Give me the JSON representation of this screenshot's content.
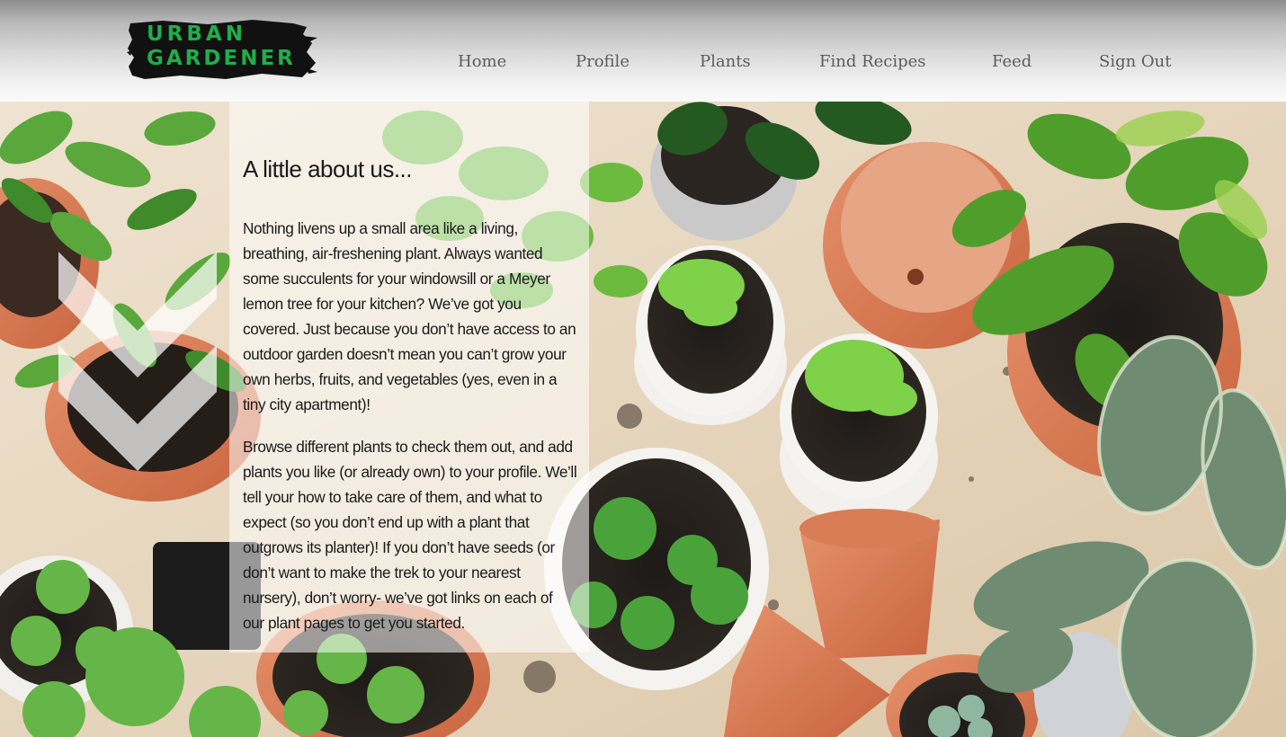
{
  "header": {
    "logo": {
      "line1": "URBAN",
      "line2": "GARDENER"
    },
    "nav": [
      {
        "label": "Home"
      },
      {
        "label": "Profile"
      },
      {
        "label": "Plants"
      },
      {
        "label": "Find Recipes"
      },
      {
        "label": "Feed"
      },
      {
        "label": "Sign Out"
      }
    ]
  },
  "about": {
    "title": "A little about us...",
    "paragraphs": [
      "Nothing livens up a small area like a living, breathing, air-freshening plant. Always wanted some succulents for your windowsill or a Meyer lemon tree for your kitchen? We’ve got you covered. Just because you don’t have access to an outdoor garden doesn’t mean you can’t grow your own herbs, fruits, and vegetables (yes, even in a tiny city apartment)!",
      "Browse different plants to check them out, and add plants you like (or already own) to your profile. We’ll tell your how to take care of them, and what to expect (so you don’t end up with a plant that outgrows its planter)! If you don’t have seeds (or don’t want to make the trek to your nearest nursery), don’t worry- we’ve got links on each of our plant pages to get you started."
    ]
  },
  "icons": {
    "scroll_down": "chevron-down-double-icon"
  },
  "colors": {
    "logo_green": "#1fae4b",
    "nav_text": "#5c5c5c",
    "panel_overlay": "rgba(255,255,255,0.55)"
  }
}
